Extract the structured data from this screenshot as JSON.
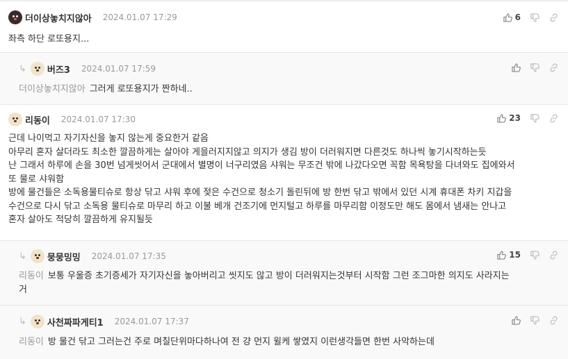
{
  "comments": [
    {
      "nickname": "더이상놓치지않아",
      "date": "2024.01.07 17:29",
      "likes": "6",
      "lines": [
        "좌측 하단 로또용지..."
      ]
    },
    {
      "nickname": "버즈3",
      "date": "2024.01.07 17:59",
      "likes": "",
      "mention": "더이상놓치지않아",
      "lines": [
        "그러게 로또용지가 짠하네.."
      ]
    },
    {
      "nickname": "리동이",
      "date": "2024.01.07 17:30",
      "likes": "23",
      "lines": [
        "근데 나이먹고 자기자신을 놓지 않는게 중요한거 같음",
        "아무리 혼자 살더라도 최소한 깔끔하게는 살아야 게을러지지않고 의지가 생김 방이 더러워지면 다른것도 하나씩 놓기시작하는듯",
        "난 그래서 하루에 손을 30번 넘게씻어서 군대에서 별명이 너구리였음 샤워는 무조건 밖에 나갔다오면 꼭함 목욕탕을 다녀와도 집에와서",
        "또 물로 샤워함",
        "방에 물건들은 소독용물티슈로 항상 닦고 샤워 후에 젖은 수건으로 청소기 돌린뒤에 방 한번 닦고 밖에서 있던 시계 휴대폰 차키 지갑을",
        "수건으로 다시 닦고 소독용 물티슈로 마무리 하고 이불 베개 건조기에 먼지털고 하루를 마무리함 이정도만 해도 몸에서 냄새는 안나고",
        "혼자 살아도 적당히 깔끔하게 유지될듯"
      ]
    },
    {
      "nickname": "뭉뭉밍밍",
      "date": "2024.01.07 17:35",
      "likes": "15",
      "mention": "리동이",
      "lines": [
        "보통 우울증 초기증세가 자기자신을 놓아버리고 씻지도 않고 방이 더러워지는것부터 시작함 그런 조그마한 의지도 사라지는",
        "거"
      ]
    },
    {
      "nickname": "사천짜파게티1",
      "date": "2024.01.07 17:37",
      "likes": "",
      "mention": "리동이",
      "lines": [
        "방 물건 닦고 그러는건 주로 며칠단위마다하나여 전 걍 먼지 윌케 쌓였지 이런생각들면 한번 사악하는데"
      ]
    }
  ]
}
